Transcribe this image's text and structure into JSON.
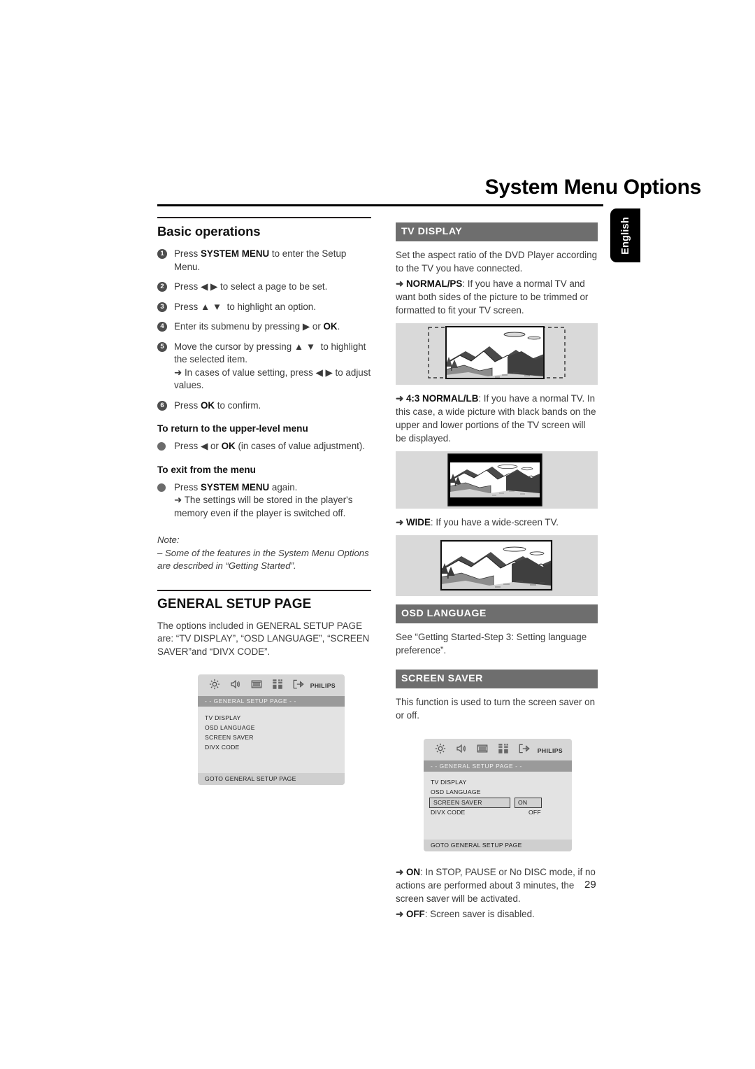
{
  "header": {
    "title": "System Menu Options",
    "language_tab": "English"
  },
  "page_number": "29",
  "left_column": {
    "basic_operations": {
      "heading": "Basic operations",
      "steps": [
        {
          "num": "1",
          "parts": [
            {
              "t": "Press ",
              "b": false
            },
            {
              "t": "SYSTEM MENU",
              "b": true
            },
            {
              "t": " to enter the Setup Menu.",
              "b": false
            }
          ]
        },
        {
          "num": "2",
          "parts": [
            {
              "t": "Press ",
              "b": false
            },
            {
              "t": "◀ ▶",
              "b": false
            },
            {
              "t": " to select a page to be set.",
              "b": false
            }
          ]
        },
        {
          "num": "3",
          "parts": [
            {
              "t": "Press ",
              "b": false
            },
            {
              "t": "▲ ▼",
              "b": false
            },
            {
              "t": "  to highlight an option.",
              "b": false
            }
          ]
        },
        {
          "num": "4",
          "parts": [
            {
              "t": "Enter its submenu by pressing ",
              "b": false
            },
            {
              "t": "▶",
              "b": false
            },
            {
              "t": " or ",
              "b": false
            },
            {
              "t": "OK",
              "b": true
            },
            {
              "t": ".",
              "b": false
            }
          ]
        },
        {
          "num": "5",
          "parts": [
            {
              "t": "Move the cursor by pressing ",
              "b": false
            },
            {
              "t": "▲ ▼",
              "b": false
            },
            {
              "t": " to highlight the selected item.",
              "b": false
            }
          ],
          "sub": "➜ In cases of value setting, press ◀ ▶ to adjust values."
        },
        {
          "num": "6",
          "parts": [
            {
              "t": "Press ",
              "b": false
            },
            {
              "t": "OK",
              "b": true
            },
            {
              "t": " to confirm.",
              "b": false
            }
          ]
        }
      ],
      "return_heading": "To return to the upper-level menu",
      "return_text_1": "Press ",
      "return_text_2": "◀",
      "return_text_3": " or ",
      "return_text_4": "OK",
      "return_text_5": " (in cases of value adjustment).",
      "exit_heading": "To exit from the menu",
      "exit_text_1": "Press ",
      "exit_text_2": "SYSTEM MENU",
      "exit_text_3": " again.",
      "exit_sub": "➜ The settings will be stored in the player's memory even if the player is switched off.",
      "note_label": "Note:",
      "note_body": "–   Some of the features in the System Menu Options are described in “Getting Started”."
    },
    "general_setup": {
      "heading": "GENERAL SETUP PAGE",
      "body": "The options included in GENERAL SETUP PAGE are: “TV DISPLAY”, “OSD LANGUAGE”, “SCREEN SAVER”and  “DIVX CODE”."
    },
    "osd_screenshot": {
      "brand": "PHILIPS",
      "title_bar": "- -  GENERAL  SETUP  PAGE  - -",
      "items": [
        "TV DISPLAY",
        "OSD LANGUAGE",
        "SCREEN SAVER",
        "DIVX CODE"
      ],
      "footer": "GOTO GENERAL SETUP PAGE",
      "icons": [
        "gear-icon",
        "speaker-icon",
        "video-icon",
        "preference-grid-icon",
        "exit-arrow-icon"
      ]
    }
  },
  "right_column": {
    "tv_display": {
      "bar": "TV DISPLAY",
      "intro": "Set the aspect ratio of the DVD Player according to the TV you have connected.",
      "normal_ps_arrow": "➜ ",
      "normal_ps_label": "NORMAL/PS",
      "normal_ps_text": ": If you have a normal TV and want both sides of the picture to be trimmed or formatted to fit your TV screen.",
      "normal_lb_arrow": "➜ ",
      "normal_lb_label": "4:3 NORMAL/LB",
      "normal_lb_text": ": If you have a normal TV. In this case, a wide picture with black bands on the upper and lower portions of the TV screen will be displayed.",
      "wide_arrow": "➜ ",
      "wide_label": "WIDE",
      "wide_text": ": If you have a wide-screen TV.",
      "illustrations": [
        "panscan-landscape",
        "letterbox-landscape",
        "widescreen-landscape"
      ]
    },
    "osd_language": {
      "bar": "OSD LANGUAGE",
      "body": "See “Getting Started-Step 3: Setting language preference”."
    },
    "screen_saver": {
      "bar": "SCREEN SAVER",
      "body": "This function is used to turn the screen saver on or off.",
      "on_arrow": "➜ ",
      "on_label": "ON",
      "on_text": ": In STOP, PAUSE or No DISC mode, if no actions are performed about 3 minutes, the screen saver will be activated.",
      "off_arrow": "➜ ",
      "off_label": "OFF",
      "off_text": ": Screen saver is disabled."
    },
    "osd_screenshot": {
      "brand": "PHILIPS",
      "title_bar": "- -  GENERAL  SETUP  PAGE  - -",
      "items": [
        "TV DISPLAY",
        "OSD LANGUAGE",
        "SCREEN SAVER",
        "DIVX CODE"
      ],
      "selected_item": "SCREEN SAVER",
      "values": [
        "ON",
        "OFF"
      ],
      "footer": "GOTO GENERAL SETUP PAGE",
      "icons": [
        "gear-icon",
        "speaker-icon",
        "video-icon",
        "preference-grid-icon",
        "exit-arrow-icon"
      ]
    }
  },
  "colors": {
    "bar_gray": "#6e6e6e",
    "illus_bg": "#d9d9d9",
    "osd_bg": "#e3e3e3",
    "text": "#3a3a3a"
  }
}
